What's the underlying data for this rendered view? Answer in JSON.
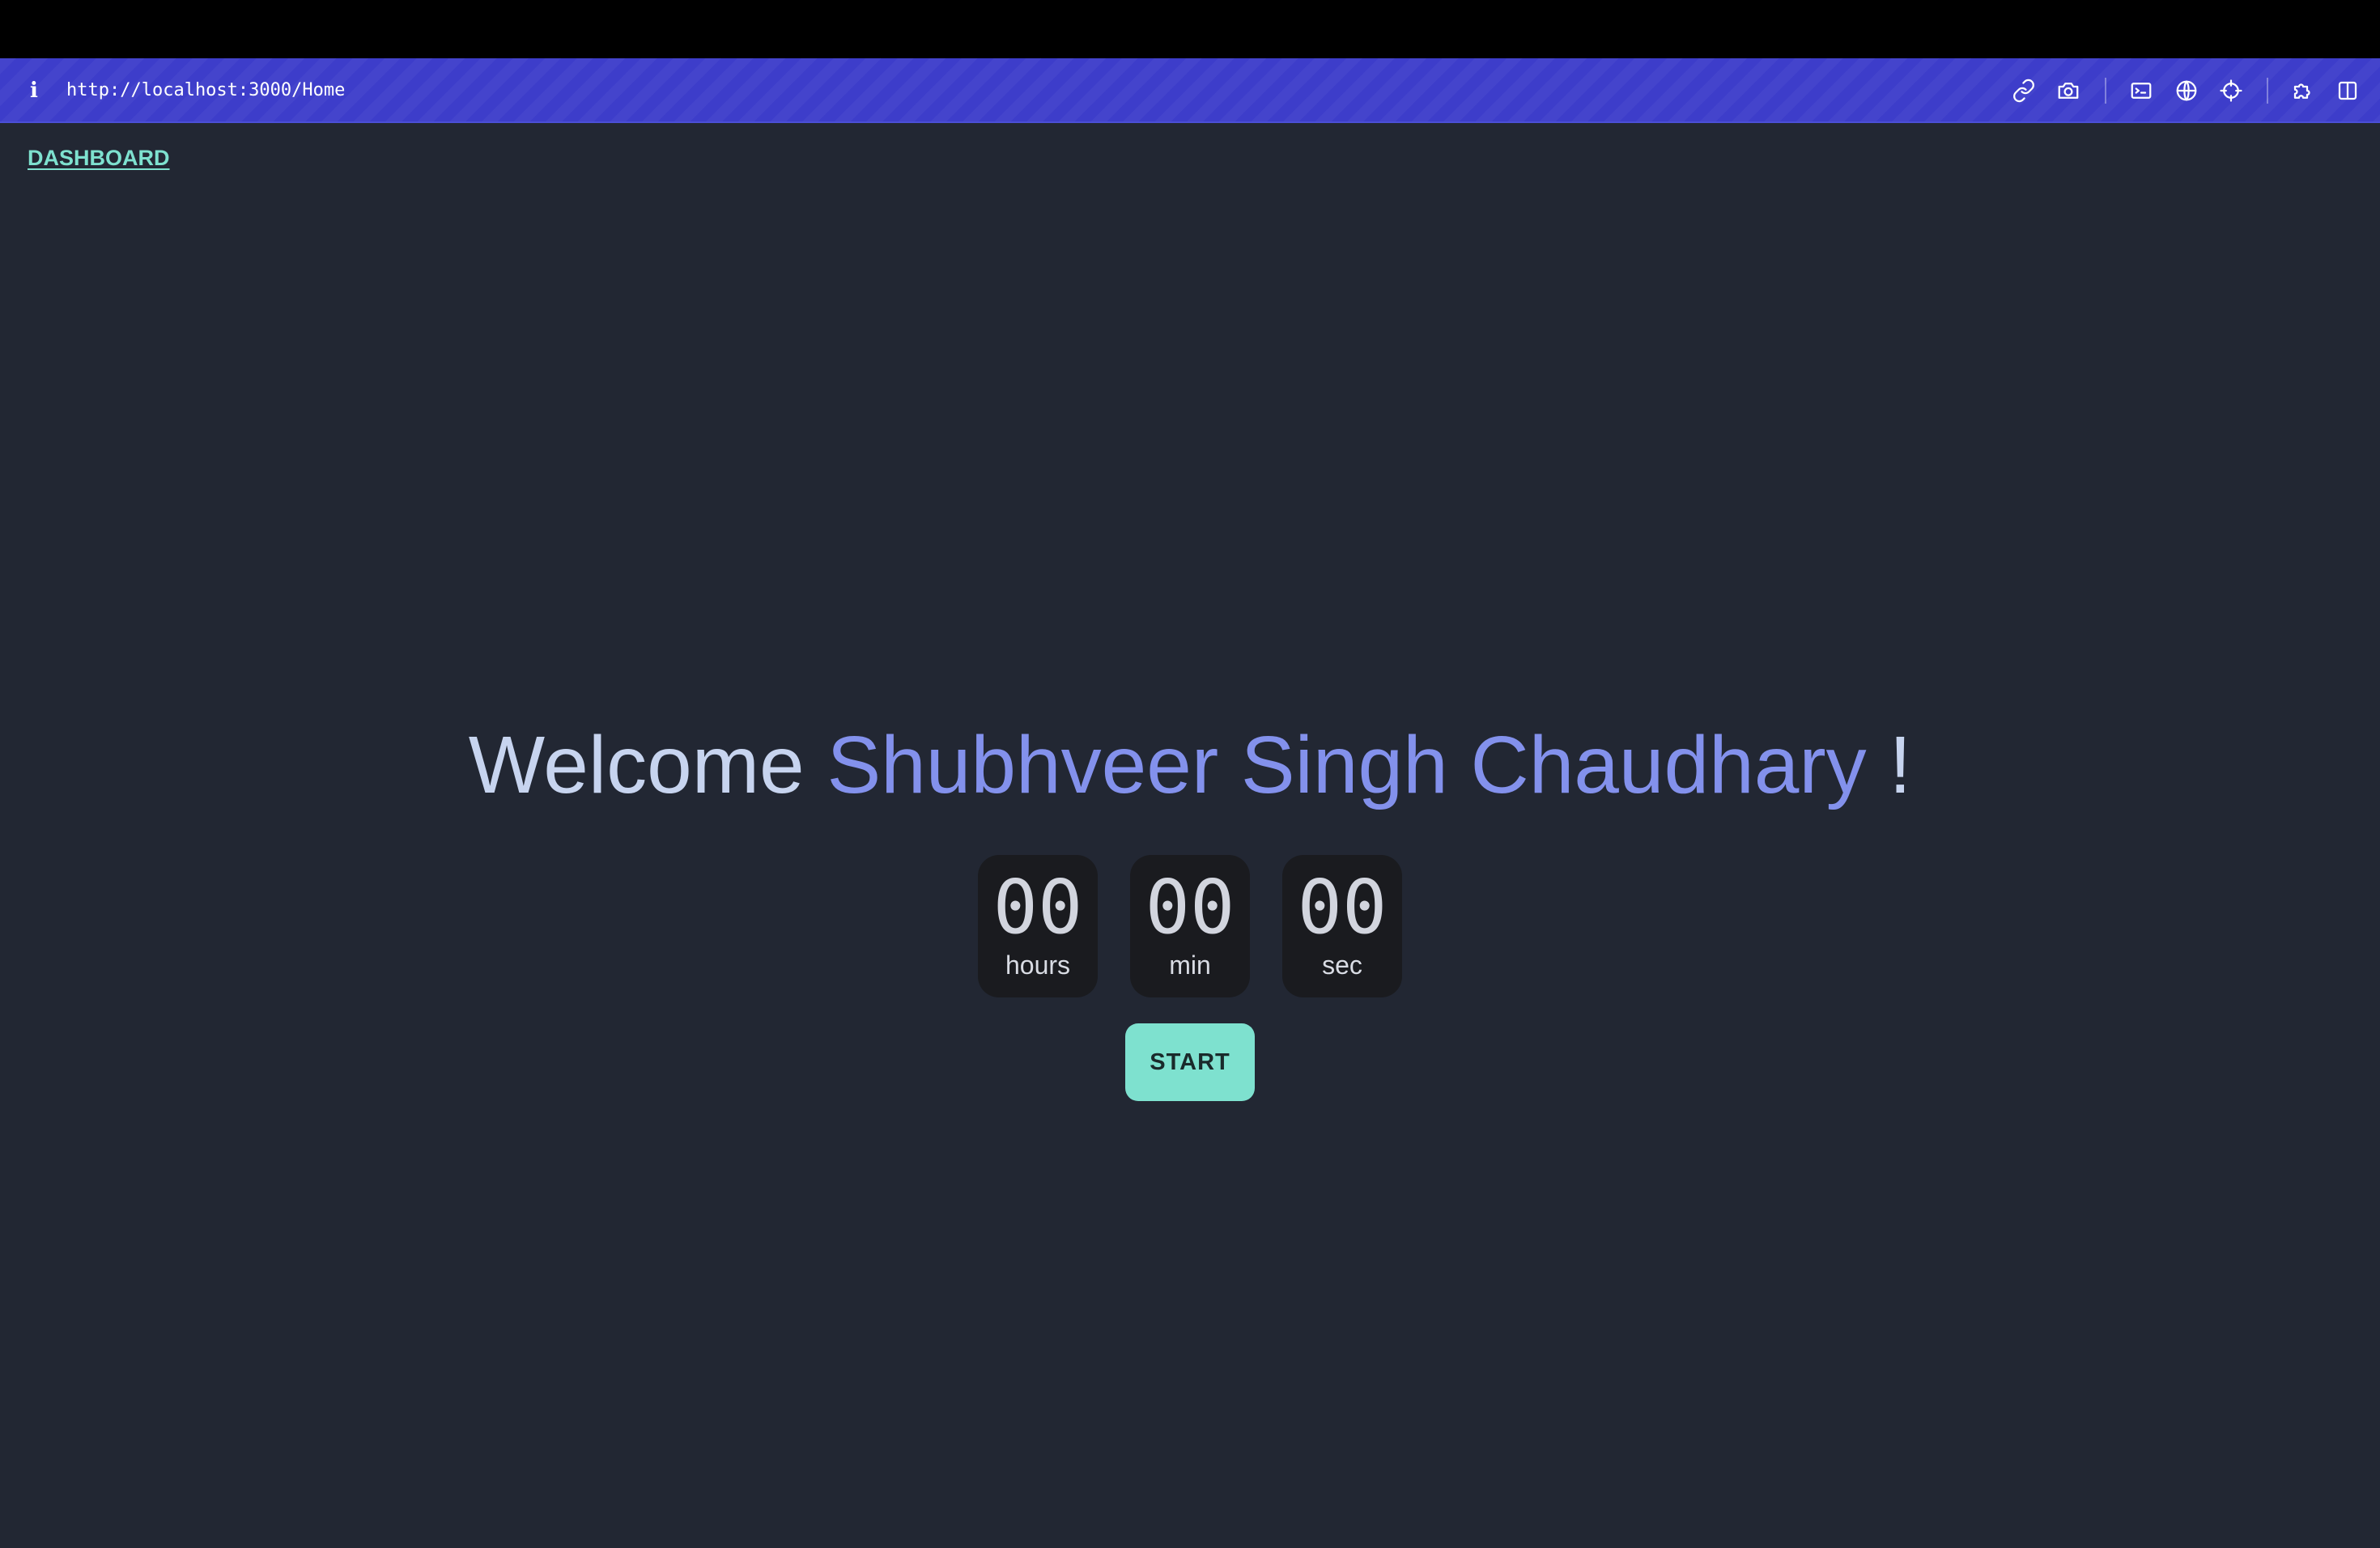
{
  "browser": {
    "url": "http://localhost:3000/Home",
    "info_icon": "i",
    "toolbar_icons": [
      "link-icon",
      "camera-icon",
      "terminal-icon",
      "globe-icon",
      "crosshair-icon",
      "extension-icon",
      "sidebar-icon"
    ],
    "accent_color": "#3d3dca"
  },
  "nav": {
    "dashboard_label": "DASHBOARD"
  },
  "welcome": {
    "greeting": "Welcome",
    "name": "Shubhveer Singh Chaudhary",
    "exclamation": "!"
  },
  "timer": {
    "hours": {
      "value": "00",
      "label": "hours"
    },
    "minutes": {
      "value": "00",
      "label": "min"
    },
    "seconds": {
      "value": "00",
      "label": "sec"
    }
  },
  "actions": {
    "start_label": "START"
  },
  "colors": {
    "background": "#222733",
    "link": "#7ee1cf",
    "name_highlight": "#8391ec",
    "button": "#7ee1cf",
    "timer_box": "#1a1b1f"
  }
}
